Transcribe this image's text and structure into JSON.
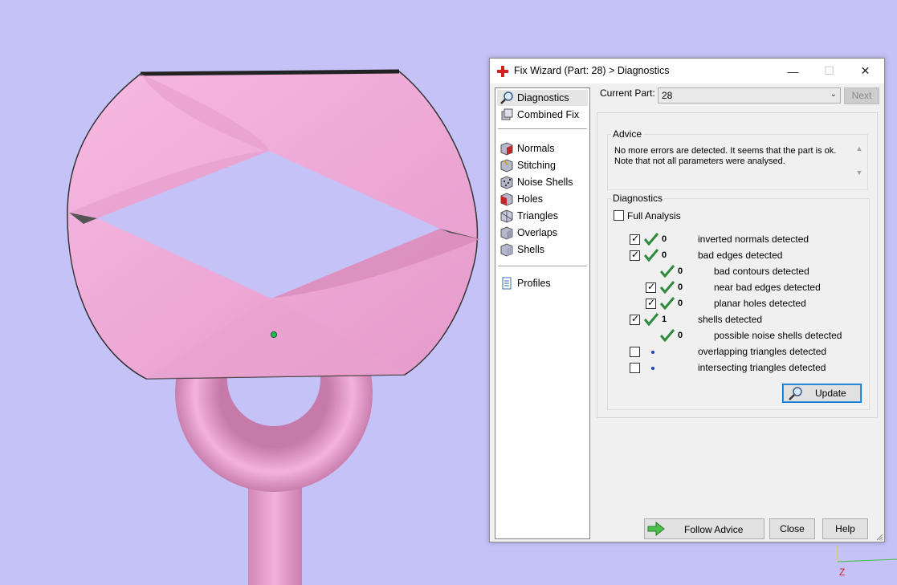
{
  "dialog": {
    "title": "Fix Wizard (Part: 28) > Diagnostics",
    "window_controls": {
      "minimize": "—",
      "maximize": "☐",
      "close": "✕"
    }
  },
  "nav": {
    "items": [
      {
        "label": "Diagnostics",
        "icon": "magnifier-icon",
        "selected": true
      },
      {
        "label": "Combined Fix",
        "icon": "combined-fix-icon"
      },
      {
        "label": "Normals",
        "icon": "normals-cube-icon"
      },
      {
        "label": "Stitching",
        "icon": "stitching-cube-icon"
      },
      {
        "label": "Noise Shells",
        "icon": "noise-shells-cube-icon"
      },
      {
        "label": "Holes",
        "icon": "holes-cube-icon"
      },
      {
        "label": "Triangles",
        "icon": "triangles-cube-icon"
      },
      {
        "label": "Overlaps",
        "icon": "overlaps-cube-icon"
      },
      {
        "label": "Shells",
        "icon": "shells-cube-icon"
      },
      {
        "label": "Profiles",
        "icon": "profiles-document-icon"
      }
    ]
  },
  "current_part": {
    "label": "Current Part:",
    "value": "28"
  },
  "next_label": "Next",
  "advice": {
    "legend": "Advice",
    "line1": "No more errors are detected. It seems that the part is ok.",
    "line2": "Note that not all parameters were analysed."
  },
  "diagnostics": {
    "legend": "Diagnostics",
    "full_analysis": {
      "label": "Full Analysis",
      "checked": false
    },
    "rows": [
      {
        "checked": true,
        "status": "ok",
        "count": "0",
        "label": "inverted normals detected",
        "indent": 0
      },
      {
        "checked": true,
        "status": "ok",
        "count": "0",
        "label": "bad edges detected",
        "indent": 0
      },
      {
        "checked": null,
        "status": "ok",
        "count": "0",
        "label": "bad contours detected",
        "indent": 1
      },
      {
        "checked": true,
        "status": "ok",
        "count": "0",
        "label": "near bad edges detected",
        "indent": 1
      },
      {
        "checked": true,
        "status": "ok",
        "count": "0",
        "label": "planar holes detected",
        "indent": 1
      },
      {
        "checked": true,
        "status": "ok",
        "count": "1",
        "label": "shells detected",
        "indent": 0
      },
      {
        "checked": null,
        "status": "ok",
        "count": "0",
        "label": "possible noise shells detected",
        "indent": 1
      },
      {
        "checked": false,
        "status": "pending",
        "count": "",
        "label": "overlapping triangles detected",
        "indent": 0
      },
      {
        "checked": false,
        "status": "pending",
        "count": "",
        "label": "intersecting triangles detected",
        "indent": 0
      }
    ]
  },
  "buttons": {
    "update": "Update",
    "follow_advice": "Follow Advice",
    "close": "Close",
    "help": "Help"
  },
  "viewport": {
    "axis_label": "Z",
    "background": "#c5c2f7",
    "part_color": "#f4b3dd"
  }
}
